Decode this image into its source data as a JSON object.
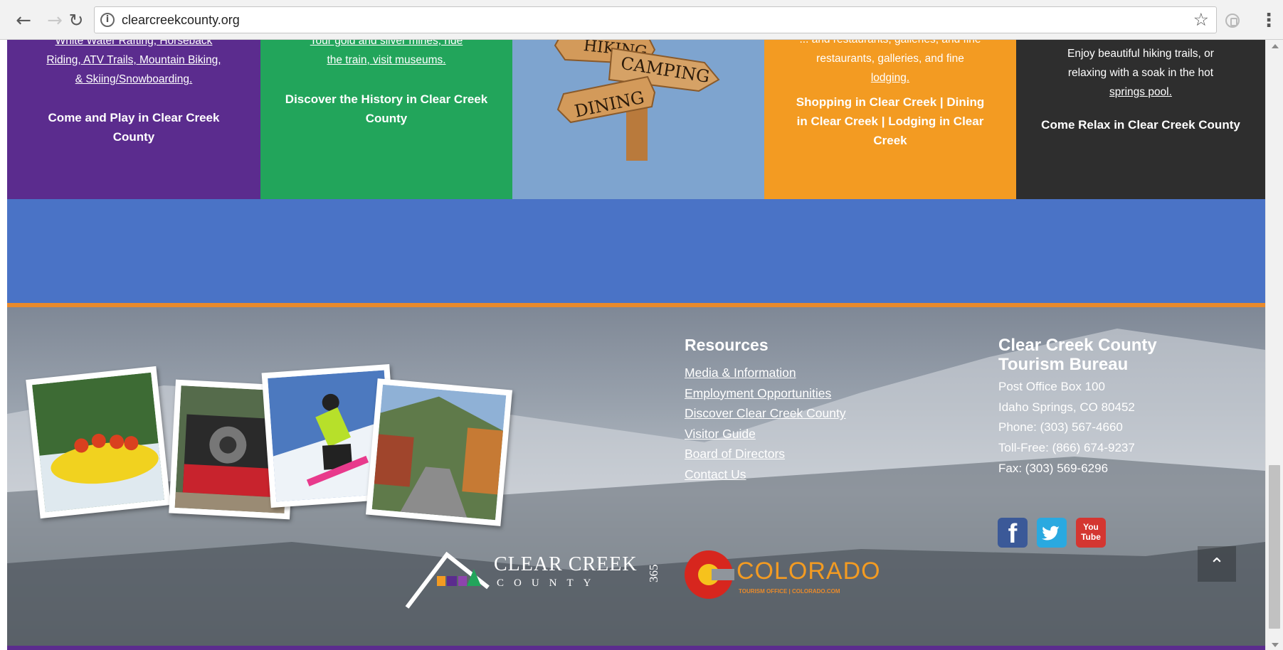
{
  "browser": {
    "url": "clearcreekcounty.org",
    "icons": [
      "back-arrow-icon",
      "forward-arrow-icon",
      "reload-icon",
      "info-icon",
      "bookmark-star-icon",
      "extension-icon",
      "menu-dots-icon"
    ]
  },
  "features": {
    "play": {
      "lines": [
        "White Water Rafting, Horseback",
        "Riding, ATV Trails, Mountain Biking,",
        "& Skiing/Snowboarding."
      ],
      "cta": "Come and Play in Clear Creek County",
      "color": "#5b2c8e"
    },
    "history": {
      "lines": [
        "Tour gold and silver mines, ride",
        "the train, visit museums."
      ],
      "cta": "Discover the History in Clear Creek County",
      "color": "#22a55b"
    },
    "signpost": {
      "sign_top": "HIKING",
      "sign_mid": "CAMPING",
      "sign_low": "DINING",
      "color": "#7ea4cf"
    },
    "shop": {
      "lines": [
        "... and restaurants, galleries, and fine",
        "restaurants, galleries, and fine",
        "lodging."
      ],
      "cta": "Shopping in Clear Creek | Dining in Clear Creek | Lodging in Clear Creek",
      "color": "#f39b22"
    },
    "relax": {
      "lines": [
        "Enjoy beautiful hiking trails, or",
        "relaxing with a soak in the hot",
        "springs pool."
      ],
      "cta": "Come Relax in Clear Creek County",
      "color": "#2e2e2e"
    }
  },
  "footer": {
    "resources_title": "Resources",
    "resources": [
      "Media & Information",
      "Employment Opportunities",
      "Discover Clear Creek County",
      "Visitor Guide",
      "Board of Directors",
      "Contact Us"
    ],
    "bureau_title": "Clear Creek County Tourism Bureau",
    "bureau_lines": [
      "Post Office Box 100",
      "Idaho Springs, CO 80452",
      "Phone: (303) 567-4660",
      "Toll-Free: (866) 674-9237",
      "Fax: (303) 569-6296"
    ],
    "social": {
      "facebook": "f",
      "youtube": "You Tube"
    },
    "clear_creek_logo": {
      "name": "CLEAR CREEK",
      "sub": "COUNTY",
      "badge": "365"
    },
    "colorado_logo": {
      "name": "COLORADO",
      "sub": "TOURISM OFFICE | COLORADO.COM"
    },
    "back_to_top": "⌃"
  },
  "colors": {
    "accent_orange": "#e98a2b",
    "band_blue": "#4a73c6"
  }
}
